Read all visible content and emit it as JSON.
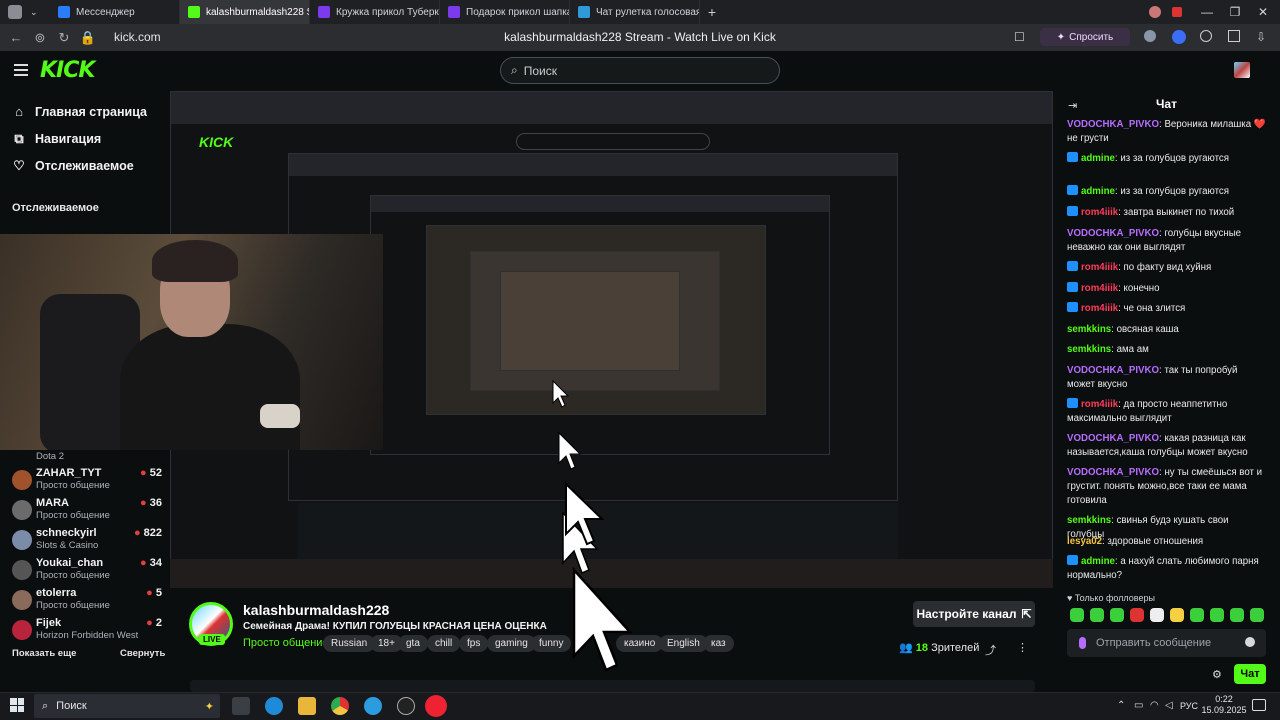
{
  "browser": {
    "tabs": [
      {
        "label": "Мессенджер",
        "color": "#2b7cff"
      },
      {
        "label": "kalashburmaldash228 S",
        "color": "#53fc18"
      },
      {
        "label": "Кружка прикол Туберкуле",
        "color": "#7c3aed"
      },
      {
        "label": "Подарок прикол шапка-к",
        "color": "#7c3aed"
      },
      {
        "label": "Чат рулетка голосовая —",
        "color": "#2f9ad8"
      }
    ],
    "url": "kick.com",
    "page_title": "kalashburmaldash228 Stream - Watch Live on Kick",
    "ask_label": "Спросить"
  },
  "header": {
    "logo": "KICK",
    "search_placeholder": "Поиск"
  },
  "sidebar": {
    "nav": [
      {
        "label": "Главная страница",
        "icon": "home-icon"
      },
      {
        "label": "Навигация",
        "icon": "compass-icon"
      },
      {
        "label": "Отслеживаемое",
        "icon": "heart-icon"
      }
    ],
    "following_title": "Отслеживаемое",
    "partial_category": "Dota 2",
    "following": [
      {
        "name": "ZAHAR_TYT",
        "category": "Просто общение",
        "viewers": "52",
        "avatar": "#a0522d"
      },
      {
        "name": "MARA",
        "category": "Просто общение",
        "viewers": "36",
        "avatar": "#6b6b6b"
      },
      {
        "name": "schneckyirl",
        "category": "Slots & Casino",
        "viewers": "822",
        "avatar": "#7a8ca8"
      },
      {
        "name": "Youkai_chan",
        "category": "Просто общение",
        "viewers": "34",
        "avatar": "#555"
      },
      {
        "name": "etolerra",
        "category": "Просто общение",
        "viewers": "5",
        "avatar": "#8a6a5a"
      },
      {
        "name": "Fijek",
        "category": "Horizon Forbidden West",
        "viewers": "2",
        "avatar": "#b8243c"
      }
    ],
    "show_more": "Показать еще",
    "collapse": "Свернуть"
  },
  "stream": {
    "streamer": "kalashburmaldash228",
    "live": "LIVE",
    "title": "Семейная Драма! КУПИЛ ГОЛУБЦЫ КРАСНАЯ ЦЕНА ОЦЕНКА",
    "category": "Просто общение",
    "tags": [
      "Russian",
      "18+",
      "gta",
      "chill",
      "fps",
      "gaming",
      "funny",
      "казино",
      "English",
      "каз"
    ],
    "setup_label": "Настройте канал",
    "viewers_count": "18",
    "viewers_label": "Зрителей"
  },
  "chat": {
    "title": "Чат",
    "messages": [
      {
        "user": "VODOCHKA_PIVKO",
        "color": "#b66cff",
        "badge": false,
        "text": "Вероника милашка ❤️ не грусти"
      },
      {
        "user": "admine",
        "color": "#53fc18",
        "badge": true,
        "text": "из за голубцов ругаются"
      },
      {
        "user": "admine",
        "color": "#53fc18",
        "badge": true,
        "text": "из за голубцов ругаются"
      },
      {
        "user": "rom4iiik",
        "color": "#ff3b5c",
        "badge": true,
        "text": "завтра выкинет по тихой"
      },
      {
        "user": "VODOCHKA_PIVKO",
        "color": "#b66cff",
        "badge": false,
        "text": "голубцы вкусные неважно как они выглядят"
      },
      {
        "user": "rom4iiik",
        "color": "#ff3b5c",
        "badge": true,
        "text": "по факту вид хуйня"
      },
      {
        "user": "rom4iiik",
        "color": "#ff3b5c",
        "badge": true,
        "text": "конечно"
      },
      {
        "user": "rom4iiik",
        "color": "#ff3b5c",
        "badge": true,
        "text": "че она злится"
      },
      {
        "user": "semkkins",
        "color": "#53fc18",
        "badge": false,
        "text": "овсяная каша"
      },
      {
        "user": "semkkins",
        "color": "#53fc18",
        "badge": false,
        "text": "ама ам"
      },
      {
        "user": "VODOCHKA_PIVKO",
        "color": "#b66cff",
        "badge": false,
        "text": "так ты попробуй может вкусно"
      },
      {
        "user": "rom4iiik",
        "color": "#ff3b5c",
        "badge": true,
        "text": "да просто неаппетитно максимально выглядит"
      },
      {
        "user": "VODOCHKA_PIVKO",
        "color": "#b66cff",
        "badge": false,
        "text": "какая разница как называется,каша голубцы может вкусно"
      },
      {
        "user": "VODOCHKA_PIVKO",
        "color": "#b66cff",
        "badge": false,
        "text": "ну ты смеёшься вот и грустит. понять можно,все таки ее мама готовила"
      },
      {
        "user": "semkkins",
        "color": "#53fc18",
        "badge": false,
        "text": "свинья будэ кушать свои голубцы"
      },
      {
        "user": "lesya02",
        "color": "#f5c542",
        "badge": false,
        "text": "здоровые отношения"
      },
      {
        "user": "admine",
        "color": "#53fc18",
        "badge": true,
        "text": "а нахуй слать любимого парня нормально?"
      }
    ],
    "followers_only": "Только фолловеры",
    "input_placeholder": "Отправить сообщение",
    "send_label": "Чат"
  },
  "taskbar": {
    "search_label": "Поиск",
    "lang": "РУС",
    "time": "0:22",
    "date": "15.09.2025"
  }
}
